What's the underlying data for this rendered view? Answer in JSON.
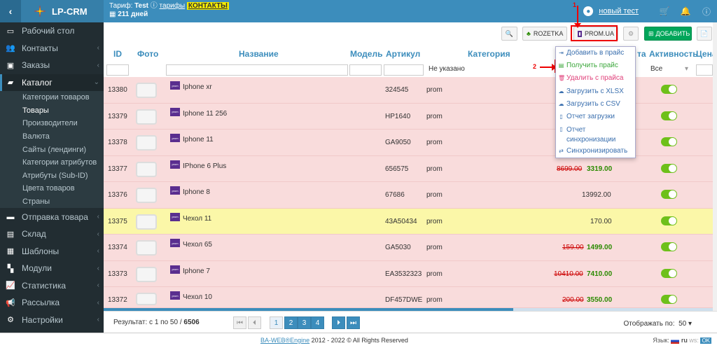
{
  "app": {
    "title": "LP-CRM"
  },
  "header": {
    "tariff_label": "Тариф:",
    "tariff_name": "Test",
    "tariffs_link": "тарифы",
    "contacts_link": "КОНТАКТЫ",
    "days": "211 дней",
    "user_name": "новый тест"
  },
  "sidebar": {
    "items": [
      {
        "label": "Рабочий стол",
        "icon": "desktop-icon"
      },
      {
        "label": "Контакты",
        "icon": "users-icon"
      },
      {
        "label": "Заказы",
        "icon": "money-icon"
      },
      {
        "label": "Каталог",
        "icon": "folder-icon"
      },
      {
        "label": "Отправка товара",
        "icon": "truck-icon"
      },
      {
        "label": "Склад",
        "icon": "archive-icon"
      },
      {
        "label": "Шаблоны",
        "icon": "templates-icon"
      },
      {
        "label": "Модули",
        "icon": "modules-icon"
      },
      {
        "label": "Статистика",
        "icon": "chart-icon"
      },
      {
        "label": "Рассылка",
        "icon": "bullhorn-icon"
      },
      {
        "label": "Настройки",
        "icon": "gear-icon"
      }
    ],
    "catalog_sub": [
      "Категории товаров",
      "Товары",
      "Производители",
      "Валюта",
      "Сайты (лендинги)",
      "Категории атрибутов",
      "Атрибуты (Sub-ID)",
      "Цвета товаров",
      "Страны"
    ]
  },
  "toolbar": {
    "rozetka": "ROZETKA",
    "prom": "PROM.UA",
    "add": "ДОБАВИТЬ"
  },
  "table": {
    "columns": [
      "ID",
      "Фото",
      "Название",
      "Модель",
      "Артикул",
      "Категория",
      "та",
      "Активность",
      "Цена"
    ],
    "filter_category": "Не указано",
    "filter_activity": "Все",
    "rows": [
      {
        "id": "13380",
        "name": "Iphone xr",
        "sku": "324545",
        "cat": "prom",
        "old": "",
        "price": ""
      },
      {
        "id": "13379",
        "name": "Iphone 11 256",
        "sku": "HP1640",
        "cat": "prom",
        "old": "",
        "price": ""
      },
      {
        "id": "13378",
        "name": "Iphone 11",
        "sku": "GA9050",
        "cat": "prom",
        "old": "",
        "price": ""
      },
      {
        "id": "13377",
        "name": "IPhone 6 Plus",
        "sku": "656575",
        "cat": "prom",
        "old": "8699.00",
        "price": "3319.00"
      },
      {
        "id": "13376",
        "name": "Iphone 8",
        "sku": "67686",
        "cat": "prom",
        "old": "",
        "price": "13992.00"
      },
      {
        "id": "13375",
        "name": "Чехол 11",
        "sku": "43A50434",
        "cat": "prom",
        "old": "",
        "price": "170.00"
      },
      {
        "id": "13374",
        "name": "Чехол 65",
        "sku": "GA5030",
        "cat": "prom",
        "old": "159.00",
        "price": "1499.00"
      },
      {
        "id": "13373",
        "name": "Iphone 7",
        "sku": "EA3532323",
        "cat": "prom",
        "old": "10410.00",
        "price": "7410.00"
      },
      {
        "id": "13372",
        "name": "Чехол 10",
        "sku": "DF457DWE",
        "cat": "prom",
        "old": "200.00",
        "price": "3550.00"
      }
    ]
  },
  "dropdown": {
    "items": [
      "Добавить в прайс",
      "Получить прайс",
      "Удалить с прайса",
      "Загрузить с XLSX",
      "Загрузить с CSV",
      "Отчет загрузки",
      "Отчет",
      "синхронизации",
      "Синхронизировать"
    ]
  },
  "annotations": {
    "one": "1",
    "two": "2"
  },
  "pagination": {
    "result_prefix": "Результат:",
    "range": "с 1 по 50 /",
    "total": "6506",
    "pages": [
      "1",
      "2",
      "3",
      "4"
    ],
    "per_page_label": "Отображать по:",
    "per_page": "50"
  },
  "footer": {
    "brand": "BA-WEB®Engine",
    "copyright": " 2012 - 2022 © All Rights Reserved",
    "lang_label": "Язык:",
    "lang": "ru"
  }
}
